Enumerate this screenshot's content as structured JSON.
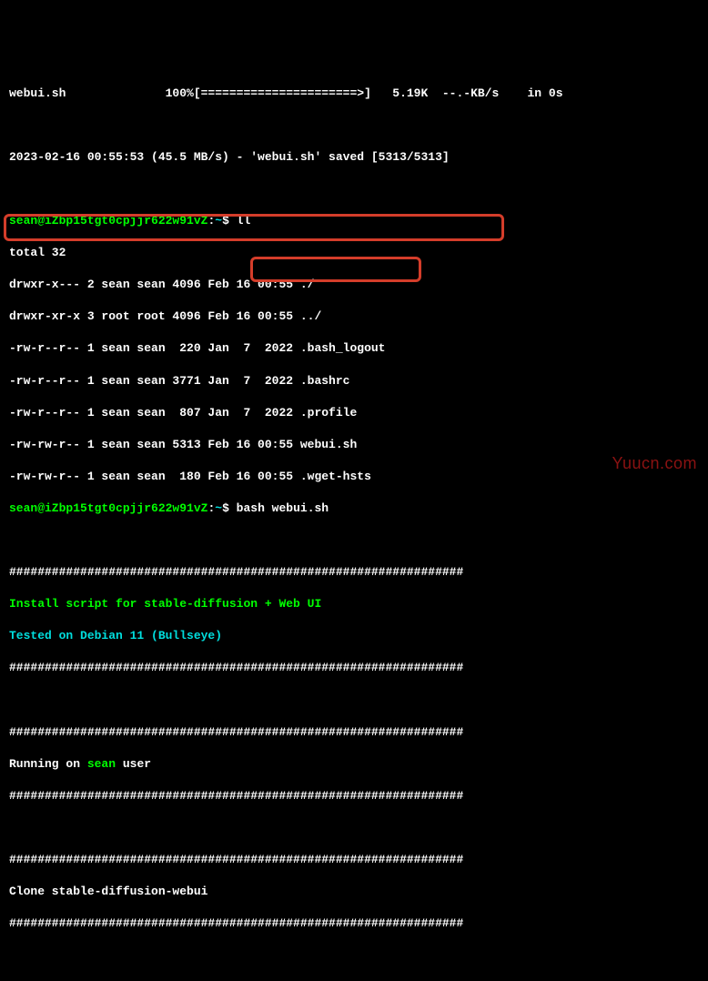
{
  "progress_line": "webui.sh              100%[======================>]   5.19K  --.-KB/s    in 0s",
  "save_line": "2023-02-16 00:55:53 (45.5 MB/s) - 'webui.sh' saved [5313/5313]",
  "prompt1_user": "sean@iZbp15tgt0cpjjr622w91vZ",
  "prompt1_cmd": " ll",
  "ll": {
    "total": "total 32",
    "l1": "drwxr-x--- 2 sean sean 4096 Feb 16 00:55 ./",
    "l2": "drwxr-xr-x 3 root root 4096 Feb 16 00:55 ../",
    "l3": "-rw-r--r-- 1 sean sean  220 Jan  7  2022 .bash_logout",
    "l4": "-rw-r--r-- 1 sean sean 3771 Jan  7  2022 .bashrc",
    "l5": "-rw-r--r-- 1 sean sean  807 Jan  7  2022 .profile",
    "l6": "-rw-rw-r-- 1 sean sean 5313 Feb 16 00:55 webui.sh",
    "l7": "-rw-rw-r-- 1 sean sean  180 Feb 16 00:55 .wget-hsts"
  },
  "prompt2_user": "sean@iZbp15tgt0cpjjr622w91vZ",
  "prompt2_cmd": " bash webui.sh",
  "hashes": "################################################################",
  "install_line": "Install script for stable-diffusion + Web UI",
  "tested_line": "Tested on Debian 11 (Bullseye)",
  "running_prefix": "Running on ",
  "running_user": "sean",
  "running_suffix": " user",
  "clone_line": "Clone stable-diffusion-webui",
  "watermark": "Yuucn.com",
  "colors": {
    "green": "#00ff00",
    "cyan": "#00dede",
    "highlight": "#d43d2a"
  }
}
